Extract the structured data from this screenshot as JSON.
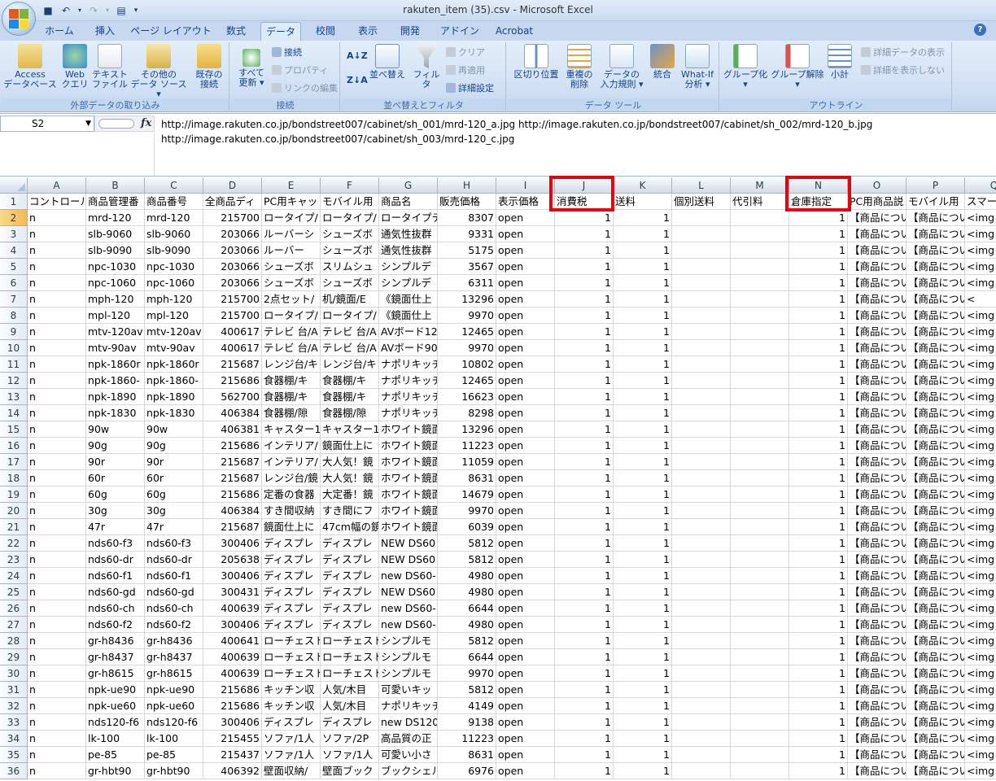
{
  "app": {
    "title": "rakuten_item (35).csv - Microsoft Excel"
  },
  "tabs": [
    "ホーム",
    "挿入",
    "ページ レイアウト",
    "数式",
    "データ",
    "校閲",
    "表示",
    "開発",
    "アドイン",
    "Acrobat"
  ],
  "active_tab": "データ",
  "ribbon": {
    "groups": [
      {
        "label": "外部データの取り込み"
      },
      {
        "label": "接続"
      },
      {
        "label": "並べ替えとフィルタ"
      },
      {
        "label": "データ ツール"
      },
      {
        "label": "アウトライン"
      }
    ],
    "buttons": {
      "access": "Access\nデータベース",
      "web": "Web\nクエリ",
      "text": "テキスト\nファイル",
      "other": "その他の\nデータ ソース ▾",
      "existing": "既存の\n接続",
      "refresh": "すべて\n更新 ▾",
      "connections": "接続",
      "properties": "プロパティ",
      "edit_links": "リンクの編集",
      "sort": "並べ替え",
      "filter": "フィルタ",
      "clear": "クリア",
      "reapply": "再適用",
      "advanced": "詳細設定",
      "text_to_cols": "区切り位置",
      "remove_dup": "重複の\n削除",
      "validation": "データの\n入力規則 ▾",
      "consolidate": "統合",
      "whatif": "What-If\n分析 ▾",
      "group": "グループ化\n▾",
      "ungroup": "グループ解除\n▾",
      "subtotal": "小計",
      "show_detail": "詳細データの表示",
      "hide_detail": "詳細を表示しない"
    }
  },
  "namebox": "S2",
  "formula": "http://image.rakuten.co.jp/bondstreet007/cabinet/sh_001/mrd-120_a.jpg http://image.rakuten.co.jp/bondstreet007/cabinet/sh_002/mrd-120_b.jpg\nhttp://image.rakuten.co.jp/bondstreet007/cabinet/sh_003/mrd-120_c.jpg",
  "columns": [
    "A",
    "B",
    "C",
    "D",
    "E",
    "F",
    "G",
    "H",
    "I",
    "J",
    "K",
    "L",
    "M",
    "N",
    "O",
    "P",
    "Q"
  ],
  "header_row": [
    "コントロール",
    "商品管理番",
    "商品番号",
    "全商品ディ",
    "PC用キャッ",
    "モバイル用",
    "商品名",
    "販売価格",
    "表示価格",
    "消費税",
    "送料",
    "個別送料",
    "代引料",
    "倉庫指定",
    "PC用商品説",
    "モバイル用",
    "スマー"
  ],
  "rows": [
    [
      "n",
      "mrd-120",
      "mrd-120",
      "215700",
      "ロータイプ/",
      "ロータイプ/",
      "ロータイプテ",
      "8307",
      "open",
      "1",
      "1",
      "",
      "",
      "1",
      "【商品につい",
      "【商品につい",
      "<img"
    ],
    [
      "n",
      "slb-9060",
      "slb-9060",
      "203066",
      "ルーバーシ",
      "シューズボ",
      "通気性抜群",
      "9331",
      "open",
      "1",
      "1",
      "",
      "",
      "1",
      "【商品につい",
      "【商品につい",
      "<img"
    ],
    [
      "n",
      "slb-9090",
      "slb-9090",
      "203066",
      "ルーバー",
      "シューズボ",
      "通気性抜群",
      "5175",
      "open",
      "1",
      "1",
      "",
      "",
      "1",
      "【商品につい",
      "【商品につい",
      "<img"
    ],
    [
      "n",
      "npc-1030",
      "npc-1030",
      "203066",
      "シューズボ",
      "スリムシュ",
      "シンプルデ",
      "3567",
      "open",
      "1",
      "1",
      "",
      "",
      "1",
      "【商品につい",
      "【商品につい",
      "<img"
    ],
    [
      "n",
      "npc-1060",
      "npc-1060",
      "203066",
      "シューズボ",
      "シューズボ",
      "シンプルデ",
      "6311",
      "open",
      "1",
      "1",
      "",
      "",
      "1",
      "【商品につい",
      "【商品につい",
      "<img"
    ],
    [
      "n",
      "mph-120",
      "mph-120",
      "215700",
      "2点セット/",
      "机/鏡面/E",
      "《鏡面仕上",
      "13296",
      "open",
      "1",
      "1",
      "",
      "",
      "1",
      "【商品につい",
      "【商品について】",
      "<"
    ],
    [
      "n",
      "mpl-120",
      "mpl-120",
      "215700",
      "ロータイプ/",
      "ロータイプ/",
      "《鏡面仕上",
      "9970",
      "open",
      "1",
      "1",
      "",
      "",
      "1",
      "【商品につい",
      "【商品につい",
      "<img"
    ],
    [
      "n",
      "mtv-120av",
      "mtv-120av",
      "400617",
      "テレビ 台/A",
      "テレビ 台/A",
      "AVボード12",
      "12465",
      "open",
      "1",
      "1",
      "",
      "",
      "1",
      "【商品につい",
      "【商品につい",
      "<img"
    ],
    [
      "n",
      "mtv-90av",
      "mtv-90av",
      "400617",
      "テレビ 台/A",
      "テレビ 台/A",
      "AVボード90",
      "9970",
      "open",
      "1",
      "1",
      "",
      "",
      "1",
      "【商品につい",
      "【商品につい",
      "<img"
    ],
    [
      "n",
      "npk-1860r",
      "npk-1860r",
      "215687",
      "レンジ台/キ",
      "レンジ台/キ",
      "ナポリキッチ",
      "10802",
      "open",
      "1",
      "1",
      "",
      "",
      "1",
      "【商品につい",
      "【商品につい",
      "<img"
    ],
    [
      "n",
      "npk-1860-",
      "npk-1860-",
      "215686",
      "食器棚/キ",
      "食器棚/キ",
      "ナポリキッチ",
      "12465",
      "open",
      "1",
      "1",
      "",
      "",
      "1",
      "【商品につい",
      "【商品につい",
      "<img"
    ],
    [
      "n",
      "npk-1890",
      "npk-1890",
      "562700",
      "食器棚/キ",
      "食器棚/キ",
      "ナポリキッチ",
      "16623",
      "open",
      "1",
      "1",
      "",
      "",
      "1",
      "【商品につい",
      "【商品につい",
      "<img"
    ],
    [
      "n",
      "npk-1830",
      "npk-1830",
      "406384",
      "食器棚/隙",
      "食器棚/隙",
      "ナポリキッチ",
      "8298",
      "open",
      "1",
      "1",
      "",
      "",
      "1",
      "【商品につい",
      "【商品につい",
      "<img"
    ],
    [
      "n",
      "90w",
      "90w",
      "406381",
      "キャスター1",
      "キャスター1",
      "ホワイト鏡面",
      "13296",
      "open",
      "1",
      "1",
      "",
      "",
      "1",
      "【商品につい",
      "【商品につい",
      "<img"
    ],
    [
      "n",
      "90g",
      "90g",
      "215686",
      "インテリア/",
      "鏡面仕上に",
      "ホワイト鏡面",
      "11223",
      "open",
      "1",
      "1",
      "",
      "",
      "1",
      "【商品につい",
      "【商品につい",
      "<img s"
    ],
    [
      "n",
      "90r",
      "90r",
      "215687",
      "インテリア/",
      "大人気！鏡",
      "ホワイト鏡面",
      "11059",
      "open",
      "1",
      "1",
      "",
      "",
      "1",
      "【商品につい",
      "【商品につい",
      "<img s"
    ],
    [
      "n",
      "60r",
      "60r",
      "215687",
      "レンジ台/鏡",
      "大人気！鏡",
      "ホワイト鏡面",
      "8631",
      "open",
      "1",
      "1",
      "",
      "",
      "1",
      "【商品につい",
      "【商品につい",
      "<img s"
    ],
    [
      "n",
      "60g",
      "60g",
      "215686",
      "定番の食器",
      "大定番！鏡",
      "ホワイト鏡面",
      "14679",
      "open",
      "1",
      "1",
      "",
      "",
      "1",
      "【商品につい",
      "【商品につい",
      "<img s"
    ],
    [
      "n",
      "30g",
      "30g",
      "406384",
      "すき間収納",
      "すき間にフ",
      "ホワイト鏡面",
      "9970",
      "open",
      "1",
      "1",
      "",
      "",
      "1",
      "【商品につい",
      "【商品につい",
      "<img s"
    ],
    [
      "n",
      "47r",
      "47r",
      "215687",
      "鏡面仕上に",
      "47cm幅の鏡",
      "ホワイト鏡面",
      "6039",
      "open",
      "1",
      "1",
      "",
      "",
      "1",
      "【商品につい",
      "【商品につい",
      "<img"
    ],
    [
      "n",
      "nds60-f3",
      "nds60-f3",
      "300406",
      "ディスプレ",
      "ディスプレ",
      "NEW DS60",
      "5812",
      "open",
      "1",
      "1",
      "",
      "",
      "1",
      "【商品につい",
      "【商品につい",
      "<img"
    ],
    [
      "n",
      "nds60-dr",
      "nds60-dr",
      "205638",
      "ディスプレ",
      "ディスプレ",
      "NEW DS60",
      "5812",
      "open",
      "1",
      "1",
      "",
      "",
      "1",
      "【商品につい",
      "【商品につい",
      "<img"
    ],
    [
      "n",
      "nds60-f1",
      "nds60-f1",
      "300406",
      "ディスプレ",
      "ディスプレ",
      "new DS60-",
      "4980",
      "open",
      "1",
      "1",
      "",
      "",
      "1",
      "【商品につい",
      "【商品につい",
      "<img"
    ],
    [
      "n",
      "nds60-gd",
      "nds60-gd",
      "300431",
      "ディスプレ",
      "ディスプレ",
      "NEW DS60",
      "4980",
      "open",
      "1",
      "1",
      "",
      "",
      "1",
      "【商品につい",
      "【商品につい",
      "<img"
    ],
    [
      "n",
      "nds60-ch",
      "nds60-ch",
      "400639",
      "ディスプレ",
      "ディスプレ",
      "new DS60-",
      "6644",
      "open",
      "1",
      "1",
      "",
      "",
      "1",
      "【商品につい",
      "【商品につい",
      "<img"
    ],
    [
      "n",
      "nds60-f2",
      "nds60-f2",
      "300406",
      "ディスプレ",
      "ディスプレ",
      "new DS60-",
      "4980",
      "open",
      "1",
      "1",
      "",
      "",
      "1",
      "【商品につい",
      "【商品につい",
      "<img"
    ],
    [
      "n",
      "gr-h8436",
      "gr-h8436",
      "400641",
      "ローチェスト",
      "ローチェスト",
      "シンプルモ",
      "5812",
      "open",
      "1",
      "1",
      "",
      "",
      "1",
      "【商品につい",
      "【商品につい",
      "<img"
    ],
    [
      "n",
      "gr-h8437",
      "gr-h8437",
      "400639",
      "ローチェスト",
      "ローチェスト",
      "シンプルモ",
      "6644",
      "open",
      "1",
      "1",
      "",
      "",
      "1",
      "【商品につい",
      "【商品につい",
      "<img"
    ],
    [
      "n",
      "gr-h8615",
      "gr-h8615",
      "400639",
      "ローチェスト",
      "ローチェスト",
      "シンプルモ",
      "9970",
      "open",
      "1",
      "1",
      "",
      "",
      "1",
      "【商品につい",
      "【商品につい",
      "<img"
    ],
    [
      "n",
      "npk-ue90",
      "npk-ue90",
      "215686",
      "キッチン収",
      "人気/木目",
      "可愛いキッ",
      "5812",
      "open",
      "1",
      "1",
      "",
      "",
      "1",
      "【商品につい",
      "【商品につい",
      "<img"
    ],
    [
      "n",
      "npk-ue60",
      "npk-ue60",
      "215686",
      "キッチン収",
      "人気/木目",
      "ナポリキッチ",
      "4149",
      "open",
      "1",
      "1",
      "",
      "",
      "1",
      "【商品につい",
      "【商品につい",
      "<img"
    ],
    [
      "n",
      "nds120-f6",
      "nds120-f6",
      "300406",
      "ディスプレ",
      "ディスプレ",
      "new DS120",
      "9138",
      "open",
      "1",
      "1",
      "",
      "",
      "1",
      "【商品につい",
      "【商品につい",
      "<img"
    ],
    [
      "n",
      "lk-100",
      "lk-100",
      "215455",
      "ソファ/1人",
      "ソファ/2P",
      "高品質の正",
      "11223",
      "open",
      "1",
      "1",
      "",
      "",
      "1",
      "【商品につい",
      "【商品につい",
      "<img"
    ],
    [
      "n",
      "pe-85",
      "pe-85",
      "215437",
      "ソファ/1人",
      "ソファ/1人",
      "可愛い小さ",
      "8631",
      "open",
      "1",
      "1",
      "",
      "",
      "1",
      "【商品につい",
      "【商品につい",
      "<img"
    ],
    [
      "n",
      "gr-hbt90",
      "gr-hbt90",
      "406392",
      "壁面収納/",
      "壁面ブック",
      "ブックシェル",
      "6976",
      "open",
      "1",
      "1",
      "",
      "",
      "1",
      "【商品につい",
      "【商品につい",
      "<img"
    ]
  ]
}
